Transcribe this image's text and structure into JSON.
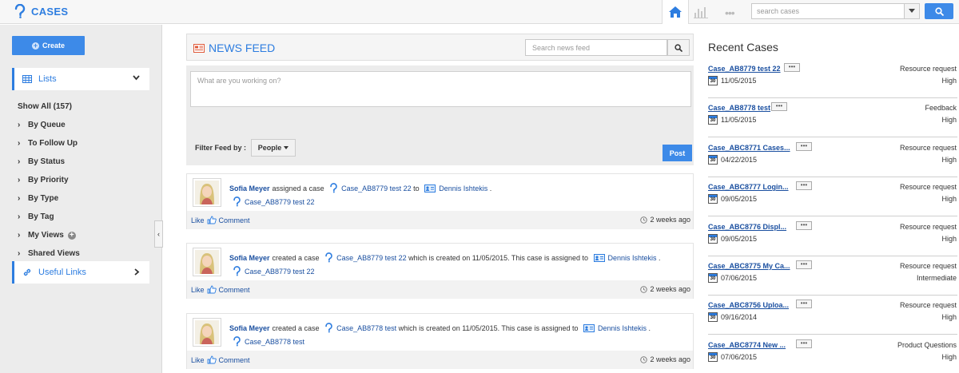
{
  "app": {
    "title": "CASES"
  },
  "topbar": {
    "search_placeholder": "search cases"
  },
  "sidebar": {
    "create_label": "Create",
    "lists_label": "Lists",
    "items": [
      {
        "label": "Show All (157)",
        "arrow": false
      },
      {
        "label": "By Queue",
        "arrow": true
      },
      {
        "label": "To Follow Up",
        "arrow": true
      },
      {
        "label": "By Status",
        "arrow": true
      },
      {
        "label": "By Priority",
        "arrow": true
      },
      {
        "label": "By Type",
        "arrow": true
      },
      {
        "label": "By Tag",
        "arrow": true
      },
      {
        "label": "My Views",
        "arrow": true,
        "add": true
      },
      {
        "label": "Shared Views",
        "arrow": true
      }
    ],
    "useful_links_label": "Useful Links"
  },
  "feed": {
    "title": "NEWS FEED",
    "search_placeholder": "Search news feed",
    "post_placeholder": "What are you working on?",
    "post_button": "Post",
    "filter_label": "Filter Feed by :",
    "filter_value": "People",
    "items": [
      {
        "actor": "Sofia Meyer",
        "parts": [
          {
            "t": "text",
            "v": "assigned a case"
          },
          {
            "t": "case",
            "v": "Case_AB8779 test 22"
          },
          {
            "t": "text",
            "v": "to"
          },
          {
            "t": "user",
            "v": "Dennis Ishtekis"
          },
          {
            "t": "text",
            "v": "."
          }
        ],
        "case_link": "Case_AB8779 test 22",
        "like": "Like",
        "comment": "Comment",
        "time": "2 weeks ago"
      },
      {
        "actor": "Sofia Meyer",
        "parts": [
          {
            "t": "text",
            "v": "created a case"
          },
          {
            "t": "case",
            "v": "Case_AB8779 test 22"
          },
          {
            "t": "text",
            "v": "which is created on 11/05/2015. This case is assigned to"
          },
          {
            "t": "user",
            "v": "Dennis Ishtekis"
          },
          {
            "t": "text",
            "v": "."
          }
        ],
        "case_link": "Case_AB8779 test 22",
        "like": "Like",
        "comment": "Comment",
        "time": "2 weeks ago"
      },
      {
        "actor": "Sofia Meyer",
        "parts": [
          {
            "t": "text",
            "v": "created a case"
          },
          {
            "t": "case",
            "v": "Case_AB8778 test"
          },
          {
            "t": "text",
            "v": "which is created on 11/05/2015. This case is assigned to"
          },
          {
            "t": "user",
            "v": "Dennis Ishtekis"
          },
          {
            "t": "text",
            "v": "."
          }
        ],
        "case_link": "Case_AB8778 test",
        "like": "Like",
        "comment": "Comment",
        "time": "2 weeks ago"
      }
    ]
  },
  "recent": {
    "title": "Recent Cases",
    "more_label": "•••",
    "calendar_day": "30",
    "cases": [
      {
        "name": "Case_AB8779 test 22",
        "date": "11/05/2015",
        "type": "Resource request",
        "priority": "High"
      },
      {
        "name": "Case_AB8778 test",
        "date": "11/05/2015",
        "type": "Feedback",
        "priority": "High"
      },
      {
        "name": "Case_ABC8771 Cases...",
        "date": "04/22/2015",
        "type": "Resource request",
        "priority": "High"
      },
      {
        "name": "Case_ABC8777 Login...",
        "date": "09/05/2015",
        "type": "Resource request",
        "priority": "High"
      },
      {
        "name": "Case_ABC8776 Displ...",
        "date": "09/05/2015",
        "type": "Resource request",
        "priority": "High"
      },
      {
        "name": "Case_ABC8775 My Ca...",
        "date": "07/06/2015",
        "type": "Resource request",
        "priority": "Intermediate"
      },
      {
        "name": "Case_ABC8756 Uploa...",
        "date": "09/16/2014",
        "type": "Resource request",
        "priority": "High"
      },
      {
        "name": "Case_ABC8774 New ...",
        "date": "07/06/2015",
        "type": "Product Questions",
        "priority": "High"
      }
    ]
  },
  "colors": {
    "accent": "#2d7de0",
    "button": "#3d8ae8",
    "link": "#1a4fa0"
  }
}
